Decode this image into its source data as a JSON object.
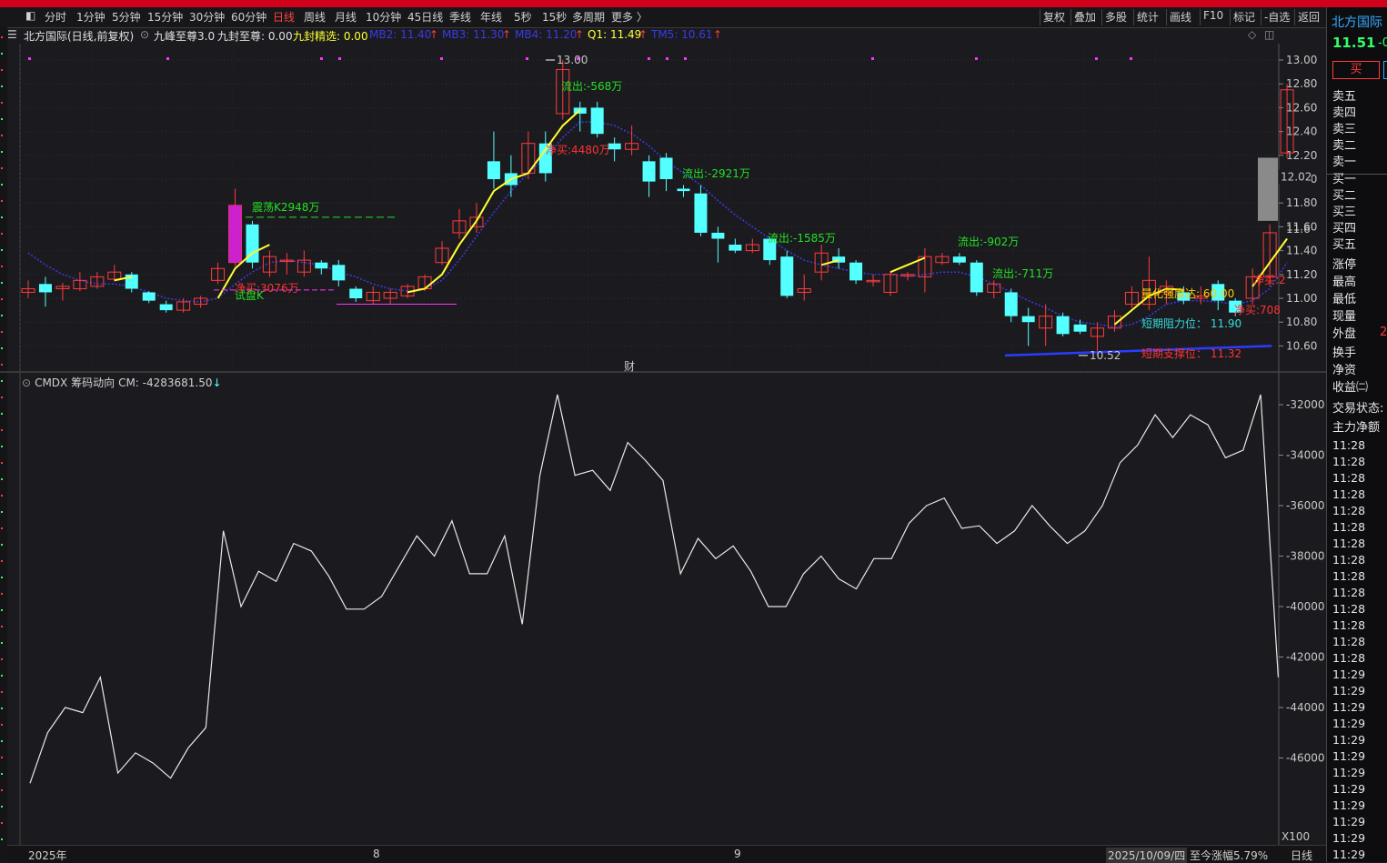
{
  "toolbar": {
    "left_tabs": [
      "分时",
      "1分钟",
      "5分钟",
      "15分钟",
      "30分钟",
      "60分钟",
      "日线",
      "周线",
      "月线",
      "10分钟",
      "45日线",
      "季线",
      "年线",
      "5秒",
      "15秒",
      "多周期",
      "更多 〉"
    ],
    "active_tab": "日线",
    "right_buttons": [
      "复权",
      "叠加",
      "多股",
      "统计",
      "画线",
      "F10",
      "标记",
      "-自选",
      "返回"
    ]
  },
  "info_bar": {
    "title": "北方国际(日线,前复权)",
    "indicator": "九峰至尊3.0",
    "jiufeng_label": "九封至尊: 0.00",
    "jingxuan_label": "九封精选: 0.00",
    "mb2": "MB2: 11.40",
    "mb3": "MB3: 11.30",
    "mb4": "MB4: 11.20",
    "q1": "Q1: 11.49",
    "tm5": "TM5: 10.61",
    "up_arrow": "↑"
  },
  "main_chart": {
    "price_ticks": [
      "13.00",
      "12.80",
      "12.60",
      "12.40",
      "12.20",
      "12.00",
      "11.80",
      "11.60",
      "11.40",
      "11.20",
      "11.00",
      "10.80",
      "10.60"
    ],
    "price_tick_values": [
      13.0,
      12.8,
      12.6,
      12.4,
      12.2,
      12.0,
      11.8,
      11.6,
      11.4,
      11.2,
      11.0,
      10.8,
      10.6
    ],
    "current_price_label": "12.02",
    "right_edge_label": "11.6",
    "max_label": "13.00",
    "min_label": "10.52",
    "cai_label": "财",
    "annotations": [
      {
        "text": "震荡K2948万",
        "color": "#22e022"
      },
      {
        "text": "净买:3076万",
        "color": "#ff3333"
      },
      {
        "text": "试盘K",
        "color": "#22e022"
      },
      {
        "text": "流出:-568万",
        "color": "#22e022"
      },
      {
        "text": "净买:4480万",
        "color": "#ff3333"
      },
      {
        "text": "流出:-2921万",
        "color": "#22e022"
      },
      {
        "text": "流出:-1585万",
        "color": "#22e022"
      },
      {
        "text": "流出:-902万",
        "color": "#22e022"
      },
      {
        "text": "流出:-711万",
        "color": "#22e022"
      },
      {
        "text": "量化强度达: 60.00",
        "color": "#ffcc00"
      },
      {
        "text": "短期阻力位： 11.90",
        "color": "#33dddd"
      },
      {
        "text": "短期支撑位： 11.32",
        "color": "#ff3333"
      },
      {
        "text": "净买:708",
        "color": "#ff3333"
      },
      {
        "text": "净买:2",
        "color": "#ff3333"
      }
    ],
    "candles": [
      [
        11.05,
        11.08,
        11.15,
        11.0
      ],
      [
        11.12,
        11.05,
        11.18,
        10.93
      ],
      [
        11.08,
        11.1,
        11.13,
        10.98
      ],
      [
        11.08,
        11.15,
        11.22,
        11.06
      ],
      [
        11.1,
        11.18,
        11.22,
        11.08
      ],
      [
        11.16,
        11.22,
        11.28,
        11.14
      ],
      [
        11.2,
        11.08,
        11.22,
        11.05
      ],
      [
        11.05,
        10.98,
        11.06,
        10.96
      ],
      [
        10.95,
        10.9,
        10.98,
        10.88
      ],
      [
        10.9,
        10.97,
        11.0,
        10.88
      ],
      [
        10.95,
        11.0,
        11.02,
        10.92
      ],
      [
        11.15,
        11.25,
        11.3,
        11.12
      ],
      [
        11.3,
        11.78,
        11.92,
        11.27
      ],
      [
        11.62,
        11.3,
        11.65,
        11.25
      ],
      [
        11.22,
        11.35,
        11.4,
        11.18
      ],
      [
        11.32,
        11.32,
        11.38,
        11.2
      ],
      [
        11.22,
        11.32,
        11.4,
        11.18
      ],
      [
        11.3,
        11.25,
        11.32,
        11.2
      ],
      [
        11.28,
        11.15,
        11.32,
        11.1
      ],
      [
        11.08,
        11.0,
        11.1,
        10.97
      ],
      [
        10.98,
        11.05,
        11.1,
        10.95
      ],
      [
        11.0,
        11.05,
        11.08,
        10.95
      ],
      [
        11.02,
        11.1,
        11.12,
        11.0
      ],
      [
        11.08,
        11.18,
        11.2,
        11.06
      ],
      [
        11.3,
        11.42,
        11.48,
        11.28
      ],
      [
        11.55,
        11.65,
        11.75,
        11.5
      ],
      [
        11.6,
        11.68,
        11.8,
        11.55
      ],
      [
        12.15,
        12.0,
        12.4,
        11.92
      ],
      [
        12.05,
        11.95,
        12.2,
        11.85
      ],
      [
        12.05,
        12.3,
        12.4,
        12.0
      ],
      [
        12.3,
        12.05,
        12.4,
        11.98
      ],
      [
        12.55,
        12.92,
        13.0,
        12.5
      ],
      [
        12.6,
        12.55,
        12.65,
        12.4
      ],
      [
        12.6,
        12.38,
        12.65,
        12.35
      ],
      [
        12.3,
        12.25,
        12.35,
        12.15
      ],
      [
        12.25,
        12.3,
        12.45,
        12.2
      ],
      [
        12.15,
        11.98,
        12.2,
        11.85
      ],
      [
        12.18,
        12.0,
        12.22,
        11.9
      ],
      [
        11.92,
        11.9,
        11.95,
        11.85
      ],
      [
        11.88,
        11.55,
        11.95,
        11.52
      ],
      [
        11.55,
        11.5,
        11.6,
        11.3
      ],
      [
        11.45,
        11.4,
        11.5,
        11.38
      ],
      [
        11.4,
        11.45,
        11.5,
        11.38
      ],
      [
        11.5,
        11.32,
        11.52,
        11.28
      ],
      [
        11.35,
        11.02,
        11.4,
        11.0
      ],
      [
        11.05,
        11.08,
        11.2,
        10.98
      ],
      [
        11.22,
        11.38,
        11.45,
        11.15
      ],
      [
        11.35,
        11.3,
        11.42,
        11.25
      ],
      [
        11.3,
        11.15,
        11.32,
        11.12
      ],
      [
        11.15,
        11.15,
        11.2,
        11.1
      ],
      [
        11.05,
        11.2,
        11.22,
        11.02
      ],
      [
        11.2,
        11.2,
        11.22,
        11.15
      ],
      [
        11.18,
        11.35,
        11.42,
        11.05
      ],
      [
        11.3,
        11.35,
        11.38,
        11.28
      ],
      [
        11.35,
        11.3,
        11.38,
        11.28
      ],
      [
        11.3,
        11.05,
        11.32,
        11.02
      ],
      [
        11.05,
        11.12,
        11.15,
        11.0
      ],
      [
        11.05,
        10.85,
        11.08,
        10.8
      ],
      [
        10.85,
        10.8,
        10.92,
        10.6
      ],
      [
        10.75,
        10.85,
        10.95,
        10.6
      ],
      [
        10.85,
        10.7,
        10.88,
        10.68
      ],
      [
        10.78,
        10.72,
        10.82,
        10.7
      ],
      [
        10.68,
        10.75,
        10.8,
        10.52
      ],
      [
        10.75,
        10.85,
        10.9,
        10.72
      ],
      [
        10.95,
        11.05,
        11.1,
        10.92
      ],
      [
        10.95,
        11.15,
        11.35,
        10.9
      ],
      [
        11.05,
        11.1,
        11.15,
        10.95
      ],
      [
        11.05,
        10.98,
        11.1,
        10.95
      ],
      [
        11.0,
        11.02,
        11.1,
        10.95
      ],
      [
        11.12,
        10.98,
        11.15,
        10.9
      ],
      [
        10.98,
        10.88,
        11.0,
        10.85
      ],
      [
        11.0,
        11.18,
        11.25,
        10.95
      ],
      [
        11.18,
        11.55,
        11.62,
        11.1
      ],
      [
        12.22,
        12.75,
        12.8,
        12.18
      ]
    ],
    "ma_line": [
      11.38,
      11.28,
      11.2,
      11.15,
      11.12,
      11.12,
      11.1,
      11.05,
      11.0,
      10.98,
      10.97,
      11.0,
      11.12,
      11.22,
      11.3,
      11.32,
      11.3,
      11.28,
      11.22,
      11.18,
      11.12,
      11.08,
      11.06,
      11.08,
      11.15,
      11.32,
      11.52,
      11.72,
      11.9,
      12.05,
      12.18,
      12.35,
      12.48,
      12.48,
      12.45,
      12.38,
      12.28,
      12.15,
      12.05,
      11.95,
      11.82,
      11.7,
      11.6,
      11.5,
      11.4,
      11.32,
      11.28,
      11.25,
      11.22,
      11.2,
      11.2,
      11.18,
      11.2,
      11.22,
      11.22,
      11.18,
      11.12,
      11.05,
      10.98,
      10.92,
      10.85,
      10.8,
      10.78,
      10.76,
      10.78,
      10.85,
      10.95,
      10.98,
      10.98,
      10.97,
      10.95,
      10.98,
      11.08,
      11.3
    ],
    "yellow_segments": [
      [
        [
          5,
          11.15
        ],
        [
          6,
          11.18
        ]
      ],
      [
        [
          11,
          11.0
        ],
        [
          12,
          11.25
        ],
        [
          13,
          11.38
        ],
        [
          14,
          11.45
        ]
      ],
      [
        [
          22,
          11.05
        ],
        [
          23,
          11.08
        ],
        [
          24,
          11.2
        ],
        [
          25,
          11.45
        ],
        [
          26,
          11.65
        ],
        [
          27,
          11.9
        ],
        [
          28,
          12.0
        ],
        [
          29,
          12.05
        ],
        [
          30,
          12.25
        ],
        [
          31,
          12.45
        ],
        [
          32,
          12.58
        ]
      ],
      [
        [
          46,
          11.28
        ],
        [
          47,
          11.32
        ]
      ],
      [
        [
          50,
          11.22
        ],
        [
          51,
          11.28
        ],
        [
          52,
          11.34
        ]
      ],
      [
        [
          63,
          10.78
        ],
        [
          64,
          10.9
        ],
        [
          65,
          11.02
        ],
        [
          66,
          11.08
        ],
        [
          67,
          11.07
        ]
      ],
      [
        [
          71,
          11.1
        ],
        [
          72,
          11.3
        ],
        [
          73,
          11.5
        ]
      ]
    ]
  },
  "sub_chart": {
    "indicator_name": "CMDX 筹码动向",
    "cm_label": "CM: -4283681.50",
    "down_arrow": "↓",
    "y_ticks": [
      "-32000",
      "-34000",
      "-36000",
      "-38000",
      "-40000",
      "-42000",
      "-44000",
      "-46000"
    ],
    "y_tick_values": [
      -32000,
      -34000,
      -36000,
      -38000,
      -40000,
      -42000,
      -44000,
      -46000
    ],
    "x100_label": "X100",
    "line_values": [
      -47000,
      -45000,
      -44000,
      -44200,
      -42800,
      -46600,
      -45800,
      -46200,
      -46800,
      -45600,
      -44800,
      -37000,
      -40000,
      -38600,
      -39000,
      -37500,
      -37800,
      -38800,
      -40100,
      -40100,
      -39600,
      -38400,
      -37200,
      -38000,
      -36600,
      -38700,
      -38700,
      -37200,
      -40700,
      -34800,
      -31600,
      -34800,
      -34600,
      -35400,
      -33500,
      -34200,
      -35000,
      -38700,
      -37300,
      -38100,
      -37600,
      -38600,
      -40000,
      -40000,
      -38700,
      -38000,
      -38900,
      -39300,
      -38100,
      -38100,
      -36700,
      -36000,
      -35700,
      -36900,
      -36800,
      -37500,
      -37000,
      -36000,
      -36800,
      -37500,
      -37000,
      -36000,
      -34300,
      -33600,
      -32400,
      -33300,
      -32400,
      -32800,
      -34100,
      -33800,
      -31600,
      -42800
    ]
  },
  "bottom_bar": {
    "x_labels": [
      "2025年",
      "8",
      "9"
    ],
    "date_label": "2025/10/09/四",
    "change_label": "至今涨幅5.79%",
    "period_label": "日线"
  },
  "right_panel": {
    "stock_name": "北方国际",
    "price": "11.51",
    "change_fragment": "-0",
    "buy_button": "买",
    "order_book": [
      "卖五",
      "卖四",
      "卖三",
      "卖二",
      "卖一",
      "买一",
      "买二",
      "买三",
      "买四",
      "买五"
    ],
    "stats": [
      "涨停",
      "最高",
      "最低",
      "现量",
      "外盘",
      "换手",
      "净资",
      "收益㈡"
    ],
    "outer_value": "2",
    "trade_status": "交易状态:",
    "net_amount": "主力净额",
    "times": [
      "11:28",
      "11:28",
      "11:28",
      "11:28",
      "11:28",
      "11:28",
      "11:28",
      "11:28",
      "11:28",
      "11:28",
      "11:28",
      "11:28",
      "11:28",
      "11:28",
      "11:29",
      "11:29",
      "11:29",
      "11:29",
      "11:29",
      "11:29",
      "11:29",
      "11:29",
      "11:29",
      "11:29",
      "11:29",
      "11:29"
    ]
  },
  "colors": {
    "up": "#ff3b3b",
    "down": "#54ffff",
    "background": "#1b1b1f",
    "ma_blue": "#3a3ae6",
    "signal_yellow": "#ffff33",
    "magenta": "#ff33ff",
    "white_line": "#e8e8e8"
  }
}
